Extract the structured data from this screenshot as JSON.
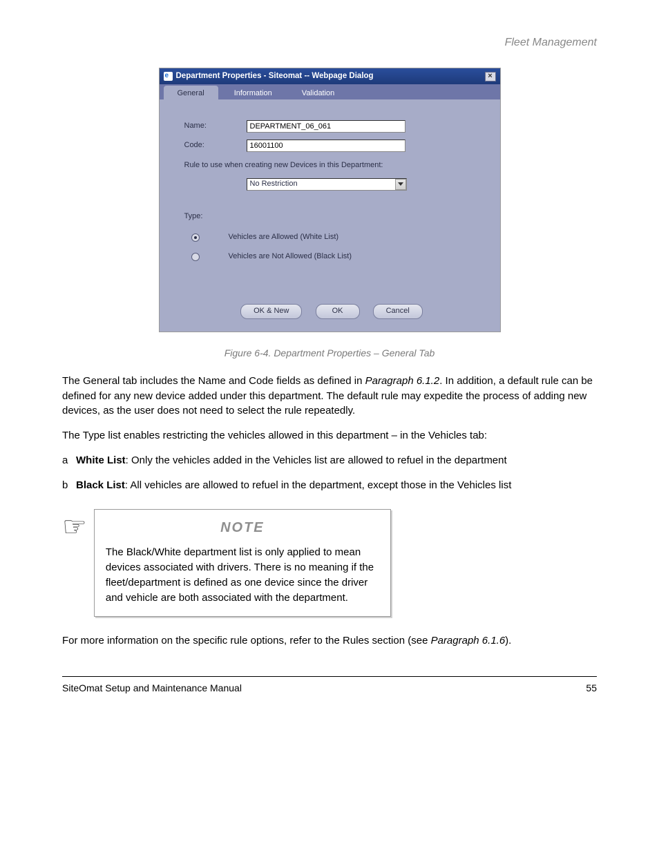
{
  "header": {
    "chapter": "Fleet Management"
  },
  "dialog": {
    "title": "Department Properties - Siteomat -- Webpage Dialog",
    "tabs": [
      "General",
      "Information",
      "Validation"
    ],
    "active_tab": 0,
    "name_label": "Name:",
    "name_value": "DEPARTMENT_06_061",
    "code_label": "Code:",
    "code_value": "16001100",
    "rule_label": "Rule to use when creating new Devices in this Department:",
    "rule_value": "No Restriction",
    "type_label": "Type:",
    "radio1": "Vehicles are Allowed (White List)",
    "radio2": "Vehicles are Not Allowed (Black List)",
    "buttons": {
      "oknew": "OK & New",
      "ok": "OK",
      "cancel": "Cancel"
    }
  },
  "caption": "Figure 6-4. Department Properties – General Tab",
  "para1_prefix": "The General tab includes the Name and Code fields as defined in ",
  "para1_link": "Paragraph 6.1.2",
  "para1_suffix": ". In addition, a default rule can be defined for any new device added under this department. The default rule may expedite the process of adding new devices, as the user does not need to select the rule repeatedly.",
  "para2": "The Type list enables restricting the vehicles allowed in this department – in the Vehicles tab:",
  "bullet_a_lead": "a",
  "bullet_a_bold": "White List",
  "bullet_a_text": ": Only the vehicles added in the Vehicles list are allowed to refuel in the department",
  "bullet_b_lead": "b",
  "bullet_b_bold": "Black List",
  "bullet_b_text": ": All vehicles are allowed to refuel in the department, except those in the Vehicles list",
  "note_title": "NOTE",
  "note_body": "The Black/White department list is only applied to mean devices associated with drivers. There is no meaning if the fleet/department is defined as one device since the driver and vehicle are both associated with the department.",
  "para3_prefix": "For more information on the specific rule options, refer to the Rules section (see ",
  "para3_link": "Paragraph 6.1.6",
  "para3_suffix": ").",
  "footer": {
    "left": "SiteOmat Setup and Maintenance Manual",
    "mid": "",
    "right": "55"
  }
}
